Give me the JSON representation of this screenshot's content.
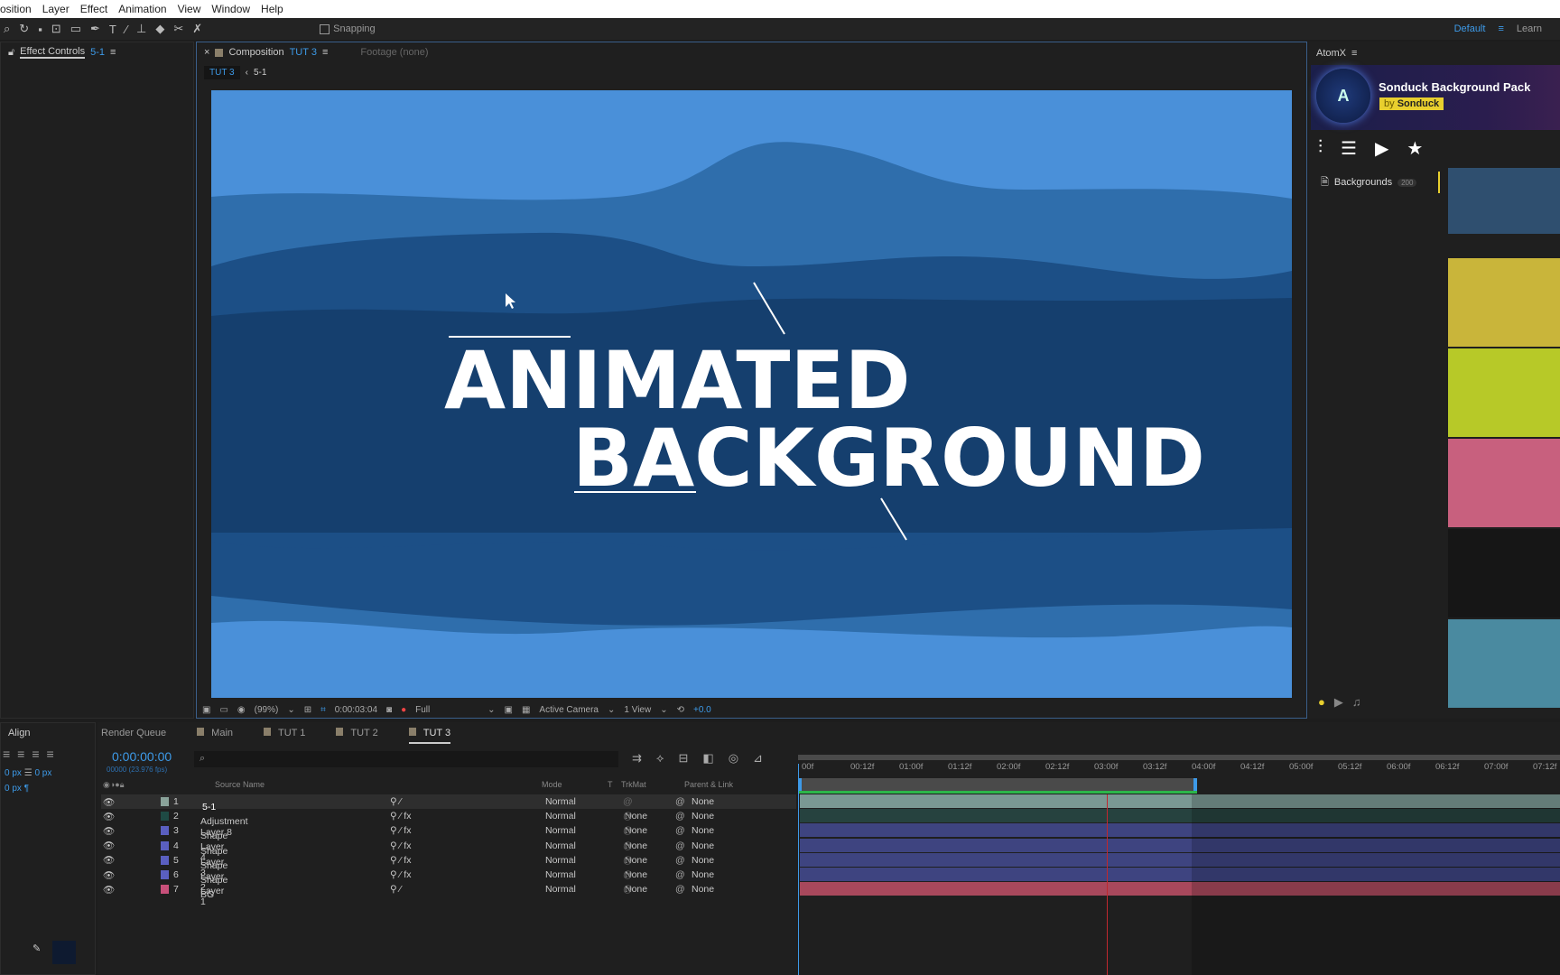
{
  "menu": [
    "osition",
    "Layer",
    "Effect",
    "Animation",
    "View",
    "Window",
    "Help"
  ],
  "toolbar": {
    "snapping": "Snapping",
    "workspace": "Default",
    "learn": "Learn"
  },
  "effect_controls": {
    "title": "Effect Controls",
    "layer": "5-1"
  },
  "composition": {
    "title": "Composition",
    "name": "TUT 3",
    "footage": "Footage (none)",
    "breadcrumb": [
      "TUT 3",
      "5-1"
    ]
  },
  "viewer": {
    "line1": "ANIMATED",
    "line2": "BACKGROUND",
    "colors": {
      "sky": "#4a90d9",
      "mid": "#2c6aa6",
      "deep": "#133f6b"
    }
  },
  "viewer_toolbar": {
    "zoom": "(99%)",
    "timecode": "0:00:03:04",
    "resolution": "Full",
    "camera": "Active Camera",
    "views": "1 View",
    "exposure": "+0.0"
  },
  "atomx": {
    "title": "AtomX",
    "pack": "Sonduck Background Pack",
    "by": "by",
    "author": "Sonduck",
    "category": "Backgrounds",
    "count": "200",
    "thumbs": [
      "#2f4f6f",
      "#c9b53a",
      "#b7c928",
      "#c8607e",
      "#161616",
      "#4a8aa0"
    ]
  },
  "align": {
    "title": "Align",
    "v1": "0 px",
    "v2": "0 px",
    "v3": "0 px"
  },
  "timeline": {
    "tabs": [
      "Render Queue",
      "Main",
      "TUT 1",
      "TUT 2",
      "TUT 3"
    ],
    "timecode": "0:00:00:00",
    "fps": "00000 (23.976 fps)",
    "headers": {
      "source": "Source Name",
      "mode": "Mode",
      "t": "T",
      "trkmat": "TrkMat",
      "parent": "Parent & Link"
    },
    "ruler": [
      "00f",
      "00:12f",
      "01:00f",
      "01:12f",
      "02:00f",
      "02:12f",
      "03:00f",
      "03:12f",
      "04:00f",
      "04:12f",
      "05:00f",
      "05:12f",
      "06:00f",
      "06:12f",
      "07:00f",
      "07:12f"
    ],
    "layers": [
      {
        "num": "1",
        "name": "5-1",
        "color": "#8aa39a",
        "mode": "Normal",
        "trkmat": "",
        "parent": "None",
        "bar": "#7a9893"
      },
      {
        "num": "2",
        "name": "Adjustment Layer 8",
        "color": "#1e4a44",
        "mode": "Normal",
        "trkmat": "None",
        "parent": "None",
        "bar": "#26423f"
      },
      {
        "num": "3",
        "name": "Shape Layer 4",
        "color": "#5a5fc0",
        "mode": "Normal",
        "trkmat": "None",
        "parent": "None",
        "bar": "#3e4480"
      },
      {
        "num": "4",
        "name": "Shape Layer 3",
        "color": "#5a5fc0",
        "mode": "Normal",
        "trkmat": "None",
        "parent": "None",
        "bar": "#3e4480"
      },
      {
        "num": "5",
        "name": "Shape Layer 2",
        "color": "#5a5fc0",
        "mode": "Normal",
        "trkmat": "None",
        "parent": "None",
        "bar": "#3e4480"
      },
      {
        "num": "6",
        "name": "Shape Layer 1",
        "color": "#5a5fc0",
        "mode": "Normal",
        "trkmat": "None",
        "parent": "None",
        "bar": "#3e4480"
      },
      {
        "num": "7",
        "name": "BG",
        "color": "#c8507a",
        "mode": "Normal",
        "trkmat": "None",
        "parent": "None",
        "bar": "#a8485c"
      }
    ]
  }
}
